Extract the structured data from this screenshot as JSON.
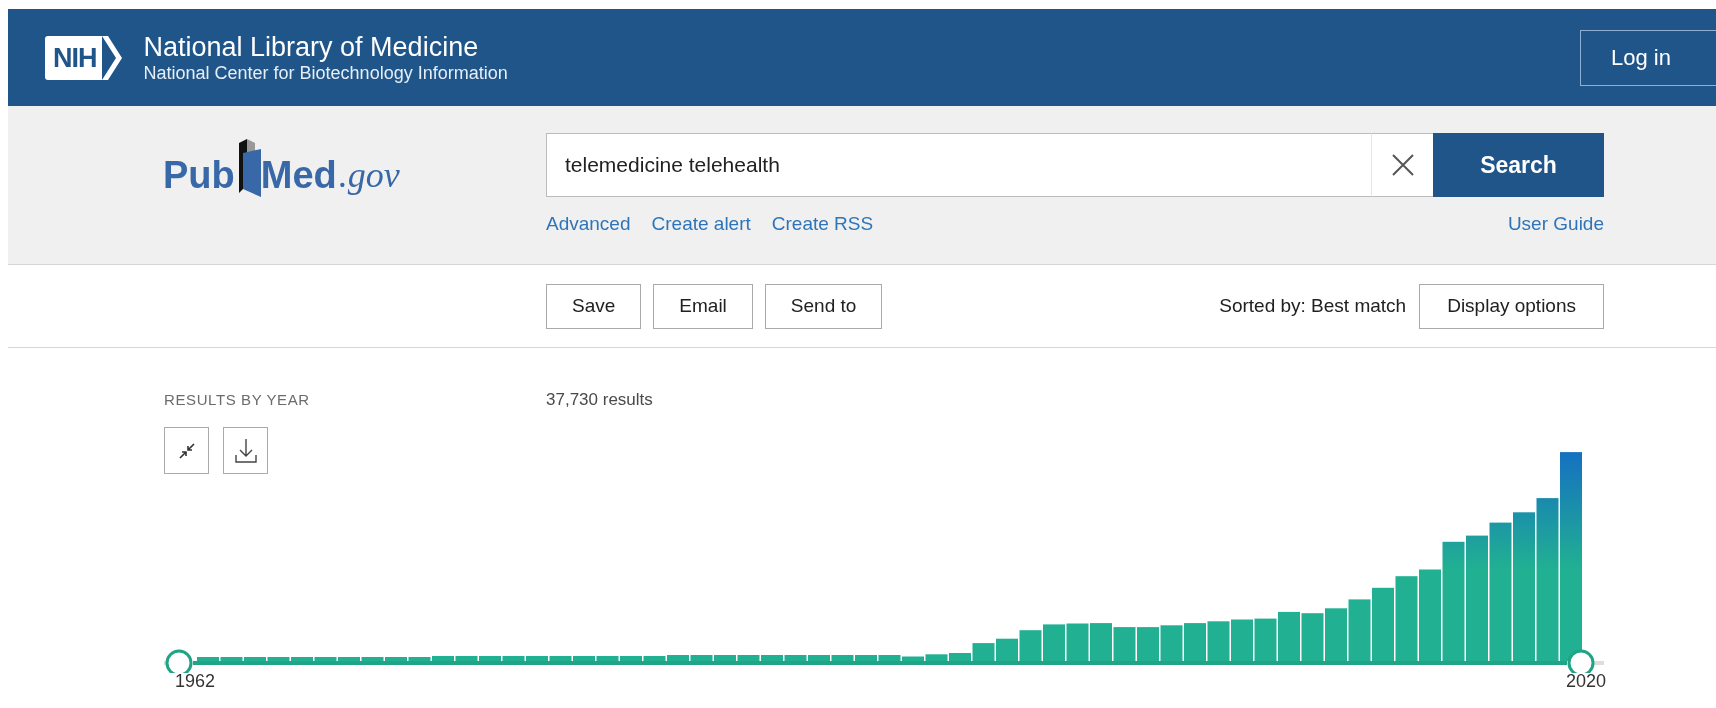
{
  "header": {
    "badge": "NIH",
    "title": "National Library of Medicine",
    "subtitle": "National Center for Biotechnology Information",
    "login": "Log in"
  },
  "search": {
    "logo": {
      "left": "Pub",
      "right": "Med",
      "domain": ".gov"
    },
    "value": "telemedicine telehealth",
    "button": "Search",
    "links": [
      "Advanced",
      "Create alert",
      "Create RSS"
    ],
    "guide_link": "User Guide"
  },
  "actions": {
    "buttons": [
      "Save",
      "Email",
      "Send to"
    ],
    "sort_label": "Sorted by: Best match",
    "display_button": "Display options"
  },
  "results": {
    "heading": "RESULTS BY YEAR",
    "count": "37,730 results",
    "timeline": {
      "start": "1962",
      "end": "2020"
    }
  }
}
